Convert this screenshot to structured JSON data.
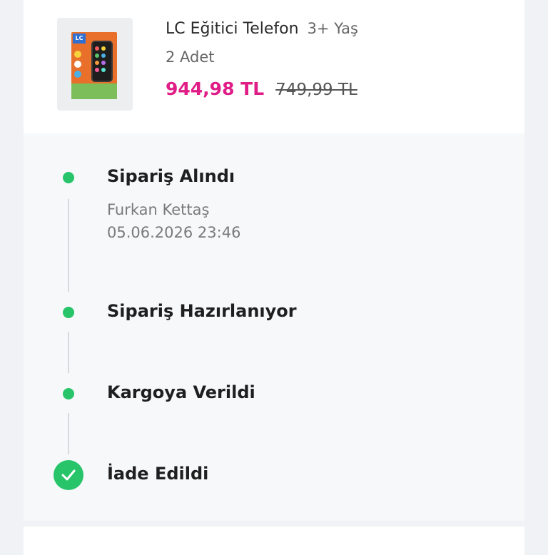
{
  "product": {
    "name": "LC Eğitici Telefon",
    "age": "3+ Yaş",
    "quantity": "2 Adet",
    "price": "944,98 TL",
    "old_price": "749,99 TL",
    "image_logo_text": "LC",
    "colors": {
      "price": "#e01c87"
    }
  },
  "timeline": {
    "steps": [
      {
        "title": "Sipariş Alındı",
        "person": "Furkan Kettaş",
        "datetime": "05.06.2026 23:46"
      },
      {
        "title": "Sipariş Hazırlanıyor"
      },
      {
        "title": "Kargoya Verildi"
      },
      {
        "title": "İade Edildi",
        "icon": "check-icon"
      }
    ],
    "colors": {
      "dot": "#27c46a",
      "line": "#d7d9dd"
    }
  }
}
